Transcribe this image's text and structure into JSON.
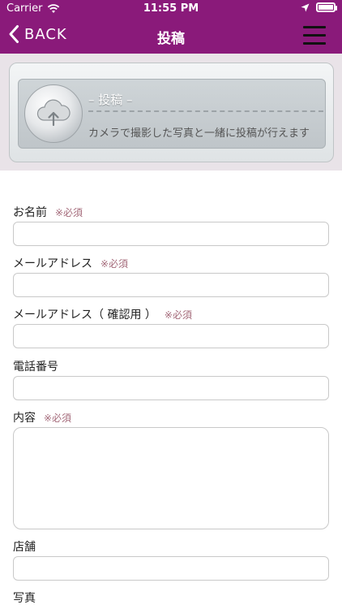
{
  "status_bar": {
    "carrier": "Carrier",
    "time": "11:55 PM",
    "icons": [
      "wifi-icon",
      "location-arrow-icon",
      "battery-icon"
    ]
  },
  "nav": {
    "back_label": "BACK",
    "title": "投稿",
    "menu_icon": "hamburger-menu-icon"
  },
  "banner": {
    "title": "– 投稿 –",
    "subtitle": "カメラで撮影した写真と一緒に投稿が行えます",
    "icon": "cloud-upload-icon"
  },
  "form": {
    "required_mark": "※必須",
    "name_label": "お名前",
    "email_label": "メールアドレス",
    "email_confirm_label": "メールアドレス（ 確認用 ）",
    "phone_label": "電話番号",
    "content_label": "内容",
    "store_label": "店舗",
    "photo_label": "写真",
    "name_value": "",
    "email_value": "",
    "email_confirm_value": "",
    "phone_value": "",
    "content_value": "",
    "store_value": ""
  },
  "colors": {
    "header": "#8a1a7a",
    "required": "#a46a7a"
  }
}
